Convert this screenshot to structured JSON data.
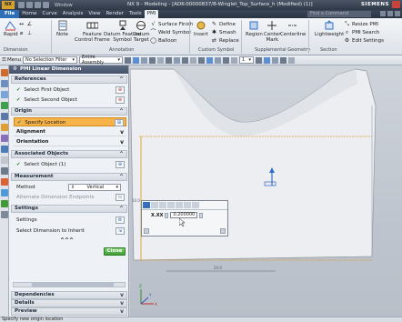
{
  "titlebar": {
    "window_menu": "Window",
    "title": "NX 9 - Modeling - [ADK-00000837/B-Winglet_Top_Surface_h (Modified)  (1)]",
    "brand": "SIEMENS",
    "logo": "NX"
  },
  "menubar": {
    "file": "File",
    "tabs": [
      "Home",
      "Curve",
      "Analysis",
      "View",
      "Render",
      "Tools",
      "PMI"
    ],
    "active_tab": "PMI",
    "find_placeholder": "Find a Command"
  },
  "ribbon": {
    "rapid": "Rapid",
    "note": "Note",
    "feature_control_frame": [
      "Feature",
      "Control Frame"
    ],
    "datum_feature_symbol": [
      "Datum Feature",
      "Symbol"
    ],
    "datum_target": [
      "Datum",
      "Target"
    ],
    "surface_finish": "Surface Finish",
    "weld_symbol": "Weld Symbol",
    "balloon": "Balloon",
    "insert": "Insert",
    "define": "Define",
    "smash": "Smash",
    "replace": "Replace",
    "region": "Region",
    "center_mark": [
      "Center",
      "Mark"
    ],
    "centerline": "Centerline",
    "lightweight": "Lightweight",
    "resize_pmi": "Resize PMI",
    "pmi_search": "PMI Search",
    "edit_settings": "Edit Settings",
    "groups": [
      "Dimension",
      "Annotation",
      "Custom Symbol",
      "Supplemental Geometry",
      "Section"
    ]
  },
  "selbar": {
    "menu": "Menu",
    "filter": "No Selection Filter",
    "scope": "Entire Assembly",
    "layer": "1"
  },
  "dialog": {
    "title": "PMI Linear Dimension",
    "references": {
      "header": "References",
      "select_first": "Select First Object",
      "select_second": "Select Second Object"
    },
    "origin": {
      "header": "Origin",
      "specify_location": "Specify Location",
      "alignment": "Alignment",
      "orientation": "Orientation"
    },
    "associated": {
      "header": "Associated Objects",
      "select_object": "Select Object (1)"
    },
    "measurement": {
      "header": "Measurement",
      "method_label": "Method",
      "method_value": "Vertical",
      "alternate": "Alternate Dimension Endpoints"
    },
    "settings": {
      "header": "Settings",
      "settings_label": "Settings",
      "select_inherit": "Select Dimension to Inherit",
      "more": "^^^",
      "close": "Close"
    },
    "navigator": [
      "Dependencies",
      "Details",
      "Preview"
    ]
  },
  "canvas": {
    "value_prefix": "X.XX",
    "value": "0.200000",
    "dim_bottom": "20.0",
    "dim_left": "10.0",
    "axes": {
      "x": "X",
      "y": "Y",
      "z": "Z"
    }
  },
  "status": "Specify new origin location",
  "colors": {
    "accent_orange": "#f5b34a",
    "close_green": "#3f9c32",
    "file_blue": "#2e6fb8",
    "dim_orange": "#e0a030"
  }
}
